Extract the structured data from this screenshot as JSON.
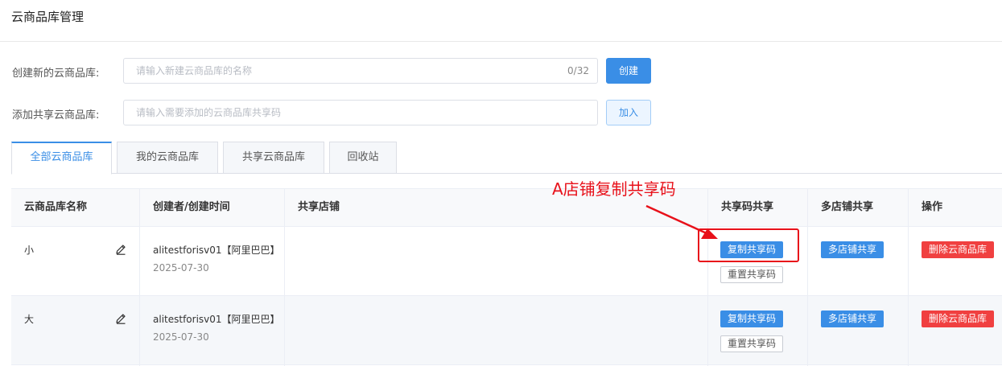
{
  "page": {
    "title": "云商品库管理"
  },
  "create_form": {
    "label": "创建新的云商品库:",
    "placeholder": "请输入新建云商品库的名称",
    "counter": "0/32",
    "button": "创建"
  },
  "share_form": {
    "label": "添加共享云商品库:",
    "placeholder": "请输入需要添加的云商品库共享码",
    "button": "加入"
  },
  "tabs": [
    {
      "label": "全部云商品库",
      "active": true
    },
    {
      "label": "我的云商品库",
      "active": false
    },
    {
      "label": "共享云商品库",
      "active": false
    },
    {
      "label": "回收站",
      "active": false
    }
  ],
  "table": {
    "headers": [
      "云商品库名称",
      "创建者/创建时间",
      "共享店铺",
      "共享码共享",
      "多店铺共享",
      "操作"
    ],
    "rows": [
      {
        "name": "小",
        "creator": "alitestforisv01【阿里巴巴】",
        "date": "2025-07-30",
        "copy_button": "复制共享码",
        "reset_button": "重置共享码",
        "multi_button": "多店铺共享",
        "delete_button": "删除云商品库"
      },
      {
        "name": "大",
        "creator": "alitestforisv01【阿里巴巴】",
        "date": "2025-07-30",
        "copy_button": "复制共享码",
        "reset_button": "重置共享码",
        "multi_button": "多店铺共享",
        "delete_button": "删除云商品库"
      }
    ]
  },
  "annotation": {
    "text": "A店铺复制共享码",
    "color": "#e8111a"
  },
  "colors": {
    "primary": "#3a8ee6",
    "danger": "#f04040"
  },
  "icons": {
    "edit": "pencil-icon"
  }
}
